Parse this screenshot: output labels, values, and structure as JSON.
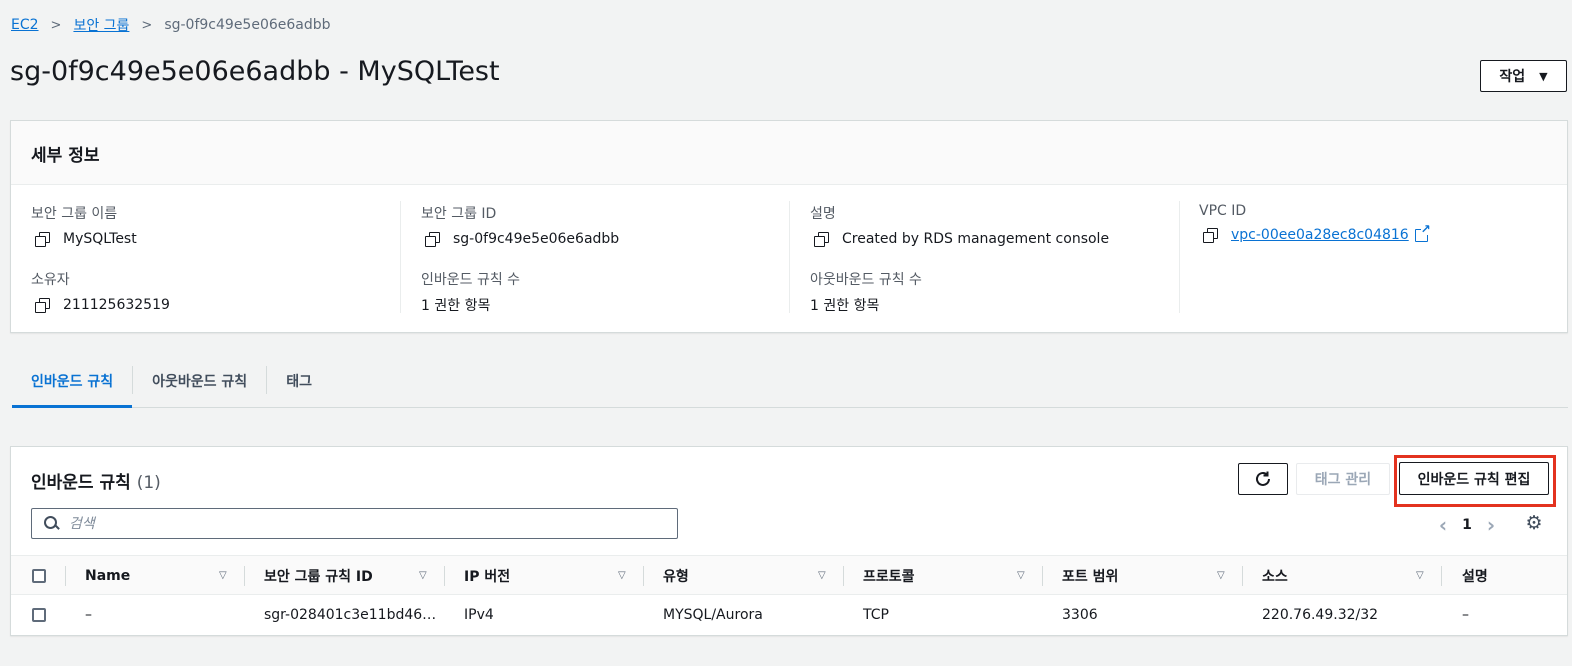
{
  "breadcrumb": {
    "ec2": "EC2",
    "security_groups": "보안 그룹",
    "current": "sg-0f9c49e5e06e6adbb"
  },
  "page_title": "sg-0f9c49e5e06e6adbb - MySQLTest",
  "actions_label": "작업",
  "details": {
    "title": "세부 정보",
    "sg_name_label": "보안 그룹 이름",
    "sg_name": "MySQLTest",
    "sg_id_label": "보안 그룹 ID",
    "sg_id": "sg-0f9c49e5e06e6adbb",
    "desc_label": "설명",
    "desc": "Created by RDS management console",
    "vpc_label": "VPC ID",
    "vpc": "vpc-00ee0a28ec8c04816",
    "owner_label": "소유자",
    "owner": "211125632519",
    "inbound_count_label": "인바운드 규칙 수",
    "inbound_count": "1 권한 항목",
    "outbound_count_label": "아웃바운드 규칙 수",
    "outbound_count": "1 권한 항목"
  },
  "tabs": [
    "인바운드 규칙",
    "아웃바운드 규칙",
    "태그"
  ],
  "rules": {
    "title": "인바운드 규칙",
    "count": "(1)",
    "manage_tags": "태그 관리",
    "edit": "인바운드 규칙 편집",
    "search_placeholder": "검색",
    "page": "1",
    "columns": [
      "Name",
      "보안 그룹 규칙 ID",
      "IP 버전",
      "유형",
      "프로토콜",
      "포트 범위",
      "소스",
      "설명"
    ],
    "rows": [
      [
        "–",
        "sgr-028401c3e11bd46…",
        "IPv4",
        "MYSQL/Aurora",
        "TCP",
        "3306",
        "220.76.49.32/32",
        "–"
      ]
    ]
  }
}
